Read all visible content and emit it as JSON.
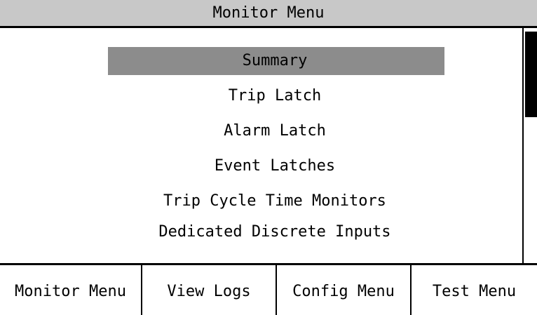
{
  "header": {
    "title": "Monitor Menu"
  },
  "menu": {
    "items": [
      {
        "label": "Summary",
        "selected": true
      },
      {
        "label": "Trip Latch",
        "selected": false
      },
      {
        "label": "Alarm Latch",
        "selected": false
      },
      {
        "label": "Event Latches",
        "selected": false
      },
      {
        "label": "Trip Cycle Time Monitors",
        "selected": false
      },
      {
        "label": "Dedicated Discrete Inputs",
        "selected": false
      }
    ],
    "selection_color": "#8c8c8c"
  },
  "softkeys": [
    {
      "label": "Monitor Menu"
    },
    {
      "label": "View Logs"
    },
    {
      "label": "Config Menu"
    },
    {
      "label": "Test Menu"
    }
  ],
  "colors": {
    "title_bar": "#c8c8c8",
    "background": "#ffffff",
    "foreground": "#000000"
  }
}
